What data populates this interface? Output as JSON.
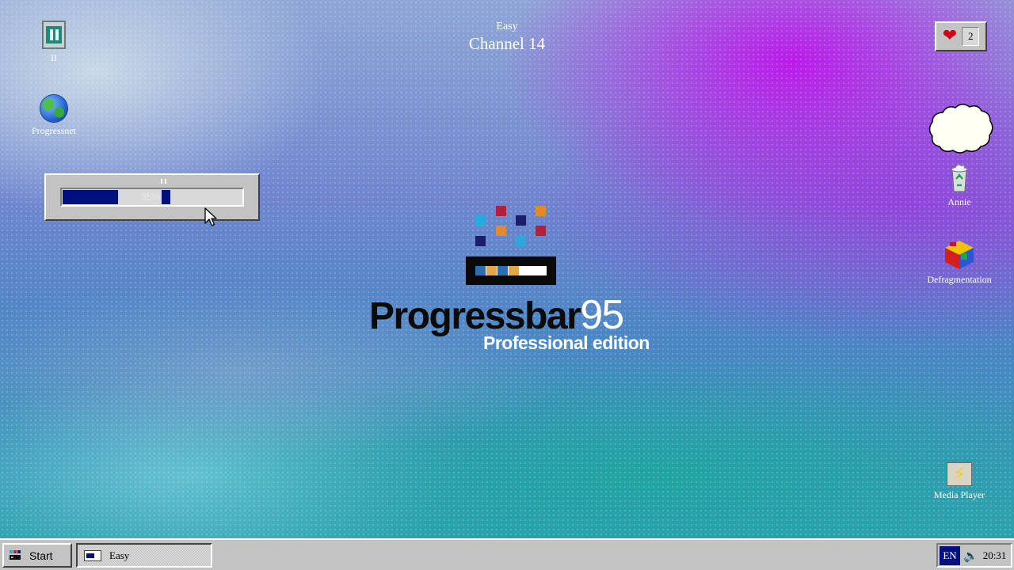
{
  "desktop": {
    "icons_left": [
      {
        "label": "II",
        "icon": "pause-window-icon"
      },
      {
        "label": "Progressnet",
        "icon": "globe-icon"
      }
    ],
    "icons_right": [
      {
        "label": "Annie",
        "icon": "recycle-bin-icon"
      },
      {
        "label": "Defragmentation",
        "icon": "defrag-cube-icon"
      },
      {
        "label": "Media Player",
        "icon": "media-player-icon"
      }
    ]
  },
  "channel": {
    "difficulty": "Easy",
    "name": "Channel 14"
  },
  "progress": {
    "percent_label": "35%",
    "value": 0.35
  },
  "lives": {
    "count": "2",
    "icon": "heart-icon",
    "color": "#d0001a"
  },
  "logo": {
    "title": "Progressbar",
    "version": "95",
    "subtitle": "Professional edition",
    "square_colors": [
      "#2aa9dd",
      "#b0223a",
      "#1b1e6a",
      "#e08a2a"
    ]
  },
  "taskbar": {
    "start_label": "Start",
    "task_item_label": "Easy",
    "language": "EN",
    "clock": "20:31",
    "accent": "#000f80"
  }
}
